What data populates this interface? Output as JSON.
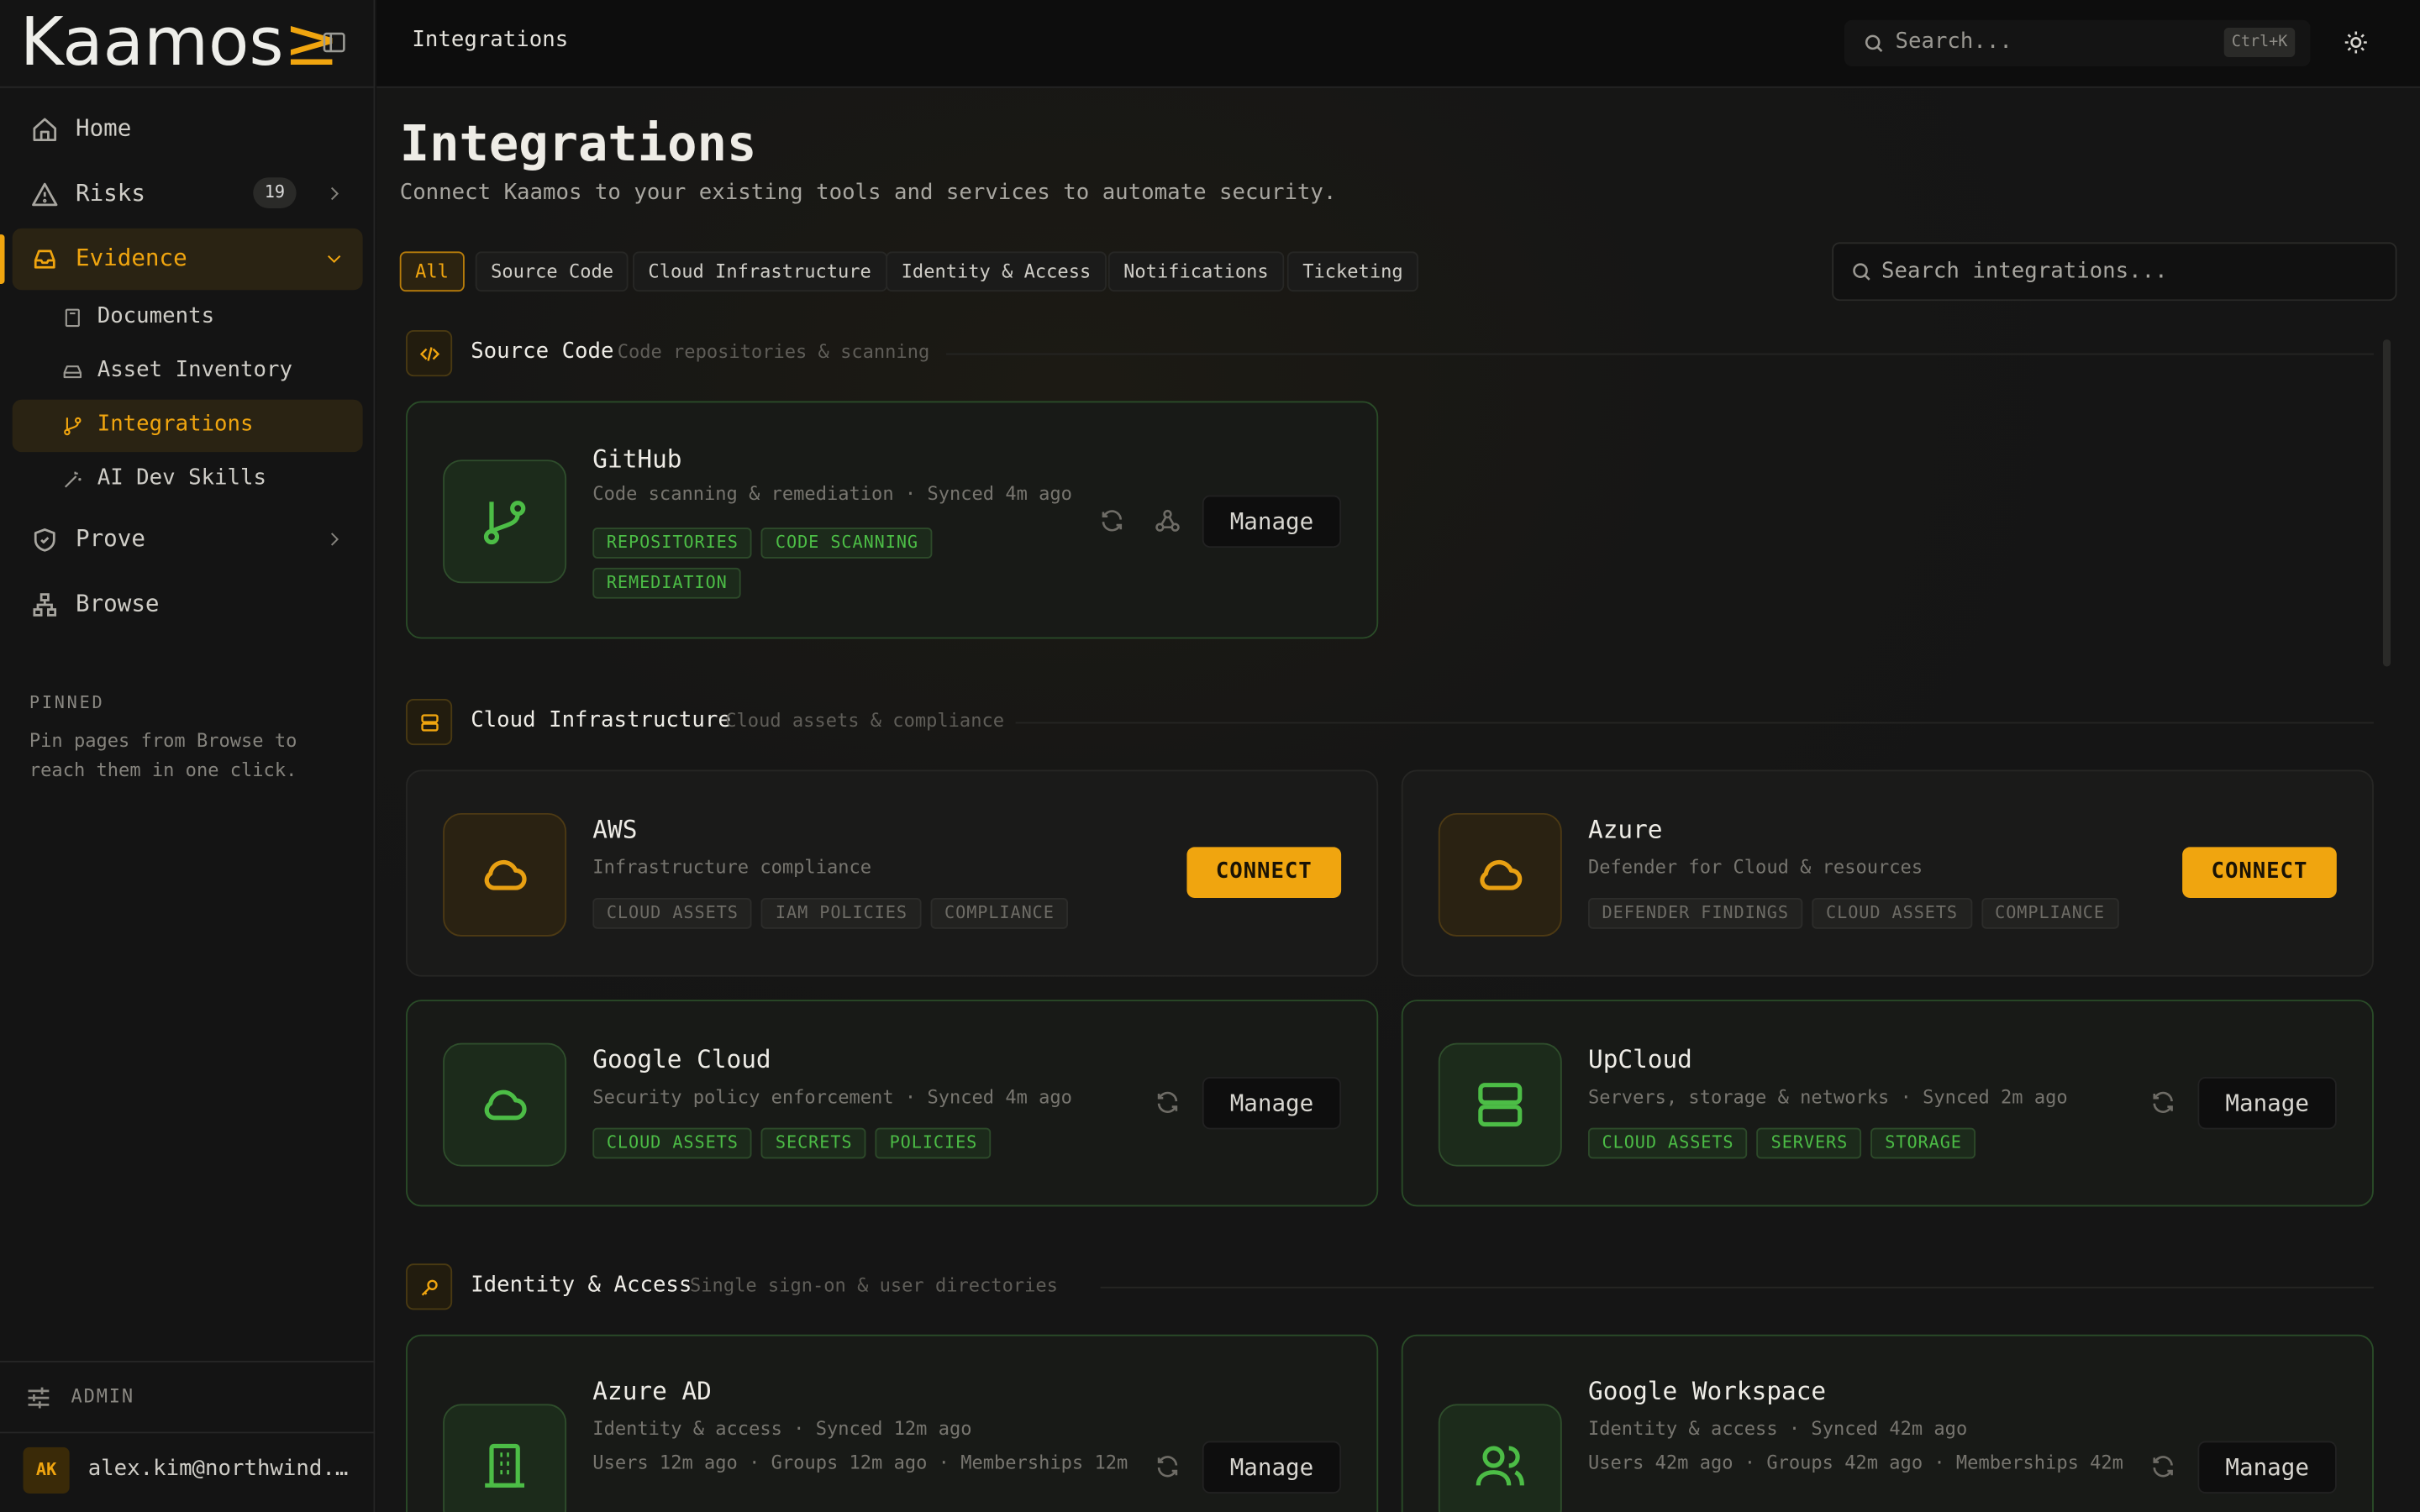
{
  "app": {
    "logo_text": "Kaamos",
    "logo_mark": "≥"
  },
  "sidebar": {
    "nav": [
      {
        "label": "Home",
        "icon": "home-icon"
      },
      {
        "label": "Risks",
        "icon": "warning-icon",
        "count": "19"
      },
      {
        "label": "Evidence",
        "icon": "inbox-icon",
        "active": true
      },
      {
        "label": "Prove",
        "icon": "shield-check-icon"
      },
      {
        "label": "Browse",
        "icon": "sitemap-icon"
      }
    ],
    "evidence_children": [
      {
        "label": "Documents",
        "icon": "book-icon"
      },
      {
        "label": "Asset Inventory",
        "icon": "drive-icon"
      },
      {
        "label": "Integrations",
        "icon": "git-branch-icon",
        "active": true
      },
      {
        "label": "AI Dev Skills",
        "icon": "wand-icon"
      }
    ],
    "pinned_title": "PINNED",
    "pinned_text": "Pin pages from Browse to reach them in one click.",
    "admin_label": "ADMIN",
    "user": {
      "initials": "AK",
      "email": "alex.kim@northwind.example"
    }
  },
  "topbar": {
    "breadcrumb": "Integrations",
    "search_placeholder": "Search...",
    "shortcut": "Ctrl+K"
  },
  "page": {
    "title": "Integrations",
    "subtitle": "Connect Kaamos to your existing tools and services to automate security.",
    "filters": [
      "All",
      "Source Code",
      "Cloud Infrastructure",
      "Identity & Access",
      "Notifications",
      "Ticketing"
    ],
    "active_filter": "All",
    "search_placeholder": "Search integrations..."
  },
  "sections": [
    {
      "name": "Source Code",
      "description": "Code repositories & scanning",
      "icon": "code-icon"
    },
    {
      "name": "Cloud Infrastructure",
      "description": "Cloud assets & compliance",
      "icon": "server-icon"
    },
    {
      "name": "Identity & Access",
      "description": "Single sign-on & user directories",
      "icon": "key-icon"
    }
  ],
  "integrations": {
    "github": {
      "name": "GitHub",
      "description": "Code scanning & remediation",
      "synced": "Synced 4m ago",
      "tags": [
        "REPOSITORIES",
        "CODE SCANNING",
        "REMEDIATION"
      ],
      "status": "connected",
      "action": "Manage",
      "icon": "git-branch-icon"
    },
    "aws": {
      "name": "AWS",
      "description": "Infrastructure compliance",
      "tags": [
        "CLOUD ASSETS",
        "IAM POLICIES",
        "COMPLIANCE"
      ],
      "status": "disconnected",
      "action": "CONNECT",
      "icon": "cloud-icon"
    },
    "azure": {
      "name": "Azure",
      "description": "Defender for Cloud & resources",
      "tags": [
        "DEFENDER FINDINGS",
        "CLOUD ASSETS",
        "COMPLIANCE"
      ],
      "status": "disconnected",
      "action": "CONNECT",
      "icon": "cloud-icon"
    },
    "gcp": {
      "name": "Google Cloud",
      "description": "Security policy enforcement",
      "synced": "Synced 4m ago",
      "tags": [
        "CLOUD ASSETS",
        "SECRETS",
        "POLICIES"
      ],
      "status": "connected",
      "action": "Manage",
      "icon": "cloud-icon"
    },
    "upcloud": {
      "name": "UpCloud",
      "description": "Servers, storage & networks",
      "synced": "Synced 2m ago",
      "tags": [
        "CLOUD ASSETS",
        "SERVERS",
        "STORAGE"
      ],
      "status": "connected",
      "action": "Manage",
      "icon": "server-icon"
    },
    "azuread": {
      "name": "Azure AD",
      "description": "Identity & access",
      "synced": "Synced 12m ago",
      "extra": "Users 12m ago · Groups 12m ago · Memberships 12m",
      "status": "connected",
      "action": "Manage",
      "icon": "building-icon"
    },
    "gworkspace": {
      "name": "Google Workspace",
      "description": "Identity & access",
      "synced": "Synced 42m ago",
      "extra": "Users 42m ago · Groups 42m ago · Memberships 42m",
      "status": "connected",
      "action": "Manage",
      "icon": "users-icon"
    }
  },
  "separator": " · ",
  "colors": {
    "accent": "#f0a50f",
    "connected": "#4cbd46",
    "background": "#131313"
  }
}
